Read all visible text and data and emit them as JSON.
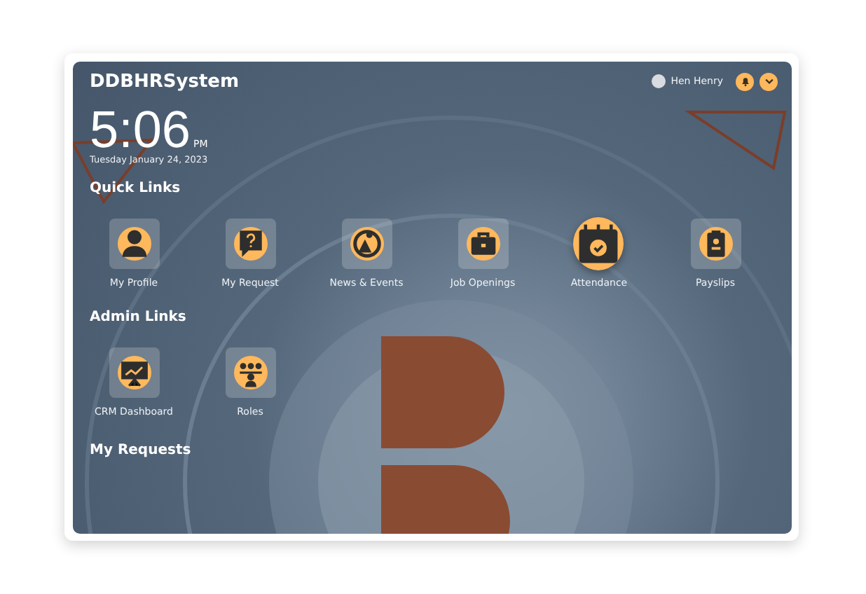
{
  "header": {
    "title": "DDBHRSystem",
    "user": "Hen Henry"
  },
  "clock": {
    "time": "5:06",
    "meridiem": "PM",
    "date": "Tuesday January 24, 2023"
  },
  "quick_links": {
    "heading": "Quick Links",
    "items": [
      {
        "label": "My Profile",
        "selected": false
      },
      {
        "label": "My Request",
        "selected": false
      },
      {
        "label": "News & Events",
        "selected": false
      },
      {
        "label": "Job Openings",
        "selected": false
      },
      {
        "label": "Attendance",
        "selected": true
      },
      {
        "label": "Payslips",
        "selected": false
      }
    ]
  },
  "admin_links": {
    "heading": "Admin Links",
    "items": [
      {
        "label": "CRM Dashboard",
        "selected": false
      },
      {
        "label": "Roles",
        "selected": false
      }
    ]
  },
  "my_requests": {
    "heading": "My Requests"
  }
}
